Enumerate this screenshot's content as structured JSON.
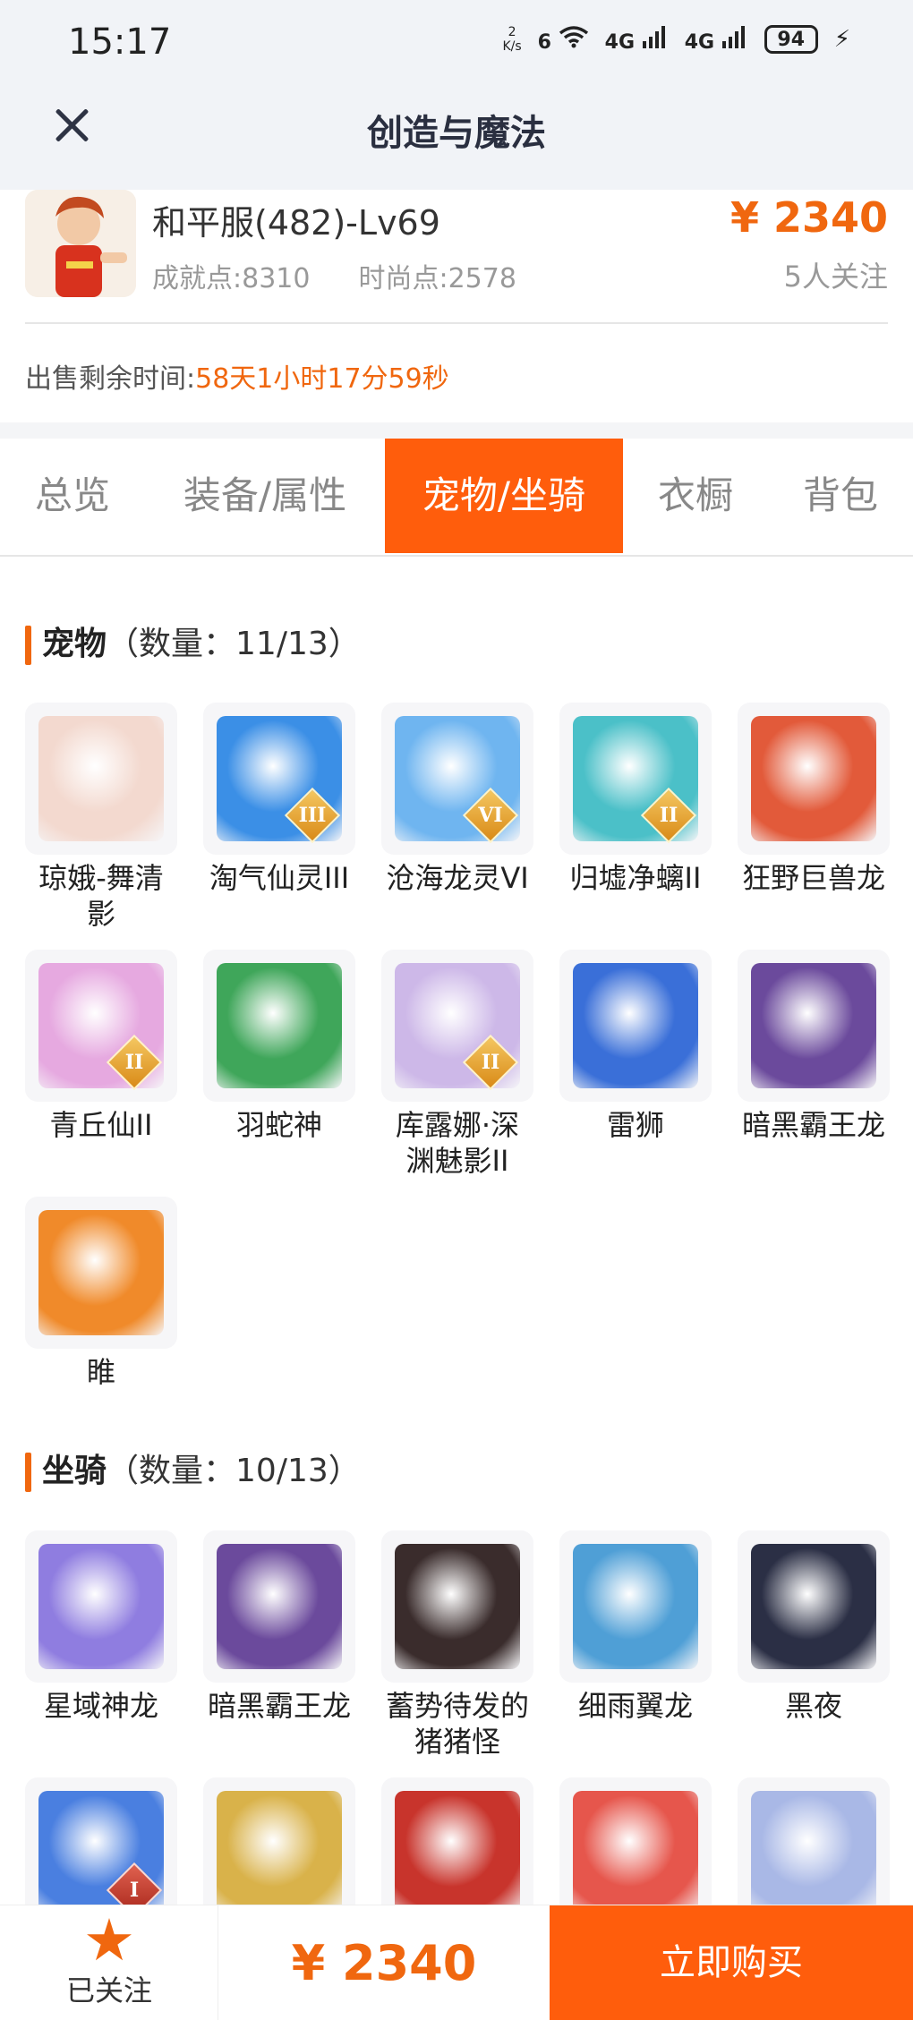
{
  "status_bar": {
    "time": "15:17",
    "net_speed_value": "2",
    "net_speed_unit": "K/s",
    "wifi_label": "6",
    "sig1": "4G",
    "sig2": "4G",
    "battery": "94"
  },
  "header": {
    "title": "创造与魔法"
  },
  "listing": {
    "role_name": "和平服(482)-Lv69",
    "achievement": "成就点:8310",
    "fashion": "时尚点:2578",
    "price": "¥ 2340",
    "followers": "5人关注",
    "sale_time_label": "出售剩余时间:",
    "sale_time_value": "58天1小时17分59秒"
  },
  "tabs": [
    "总览",
    "装备/属性",
    "宠物/坐骑",
    "衣橱",
    "背包"
  ],
  "active_tab": "宠物/坐骑",
  "pets": {
    "title": "宠物",
    "count": "（数量：11/13）",
    "items": [
      {
        "name": "琼娥-舞清影",
        "badge": "",
        "color": "#f3d9cf"
      },
      {
        "name": "淘气仙灵III",
        "badge": "III",
        "color": "#3b8fe6"
      },
      {
        "name": "沧海龙灵VI",
        "badge": "VI",
        "color": "#6fb5f0"
      },
      {
        "name": "归墟净螭II",
        "badge": "II",
        "color": "#4bc0c8"
      },
      {
        "name": "狂野巨兽龙",
        "badge": "",
        "color": "#e25a3a"
      },
      {
        "name": "青丘仙II",
        "badge": "II",
        "color": "#e6a9e0"
      },
      {
        "name": "羽蛇神",
        "badge": "",
        "color": "#3fa65a"
      },
      {
        "name": "库露娜·深渊魅影II",
        "badge": "II",
        "color": "#cdb8e8"
      },
      {
        "name": "雷狮",
        "badge": "",
        "color": "#3a6fd8"
      },
      {
        "name": "暗黑霸王龙",
        "badge": "",
        "color": "#6b4a9c"
      },
      {
        "name": "睢",
        "badge": "",
        "color": "#f08a2a"
      }
    ]
  },
  "mounts": {
    "title": "坐骑",
    "count": "（数量：10/13）",
    "items": [
      {
        "name": "星域神龙",
        "badge": "",
        "color": "#8f7de0"
      },
      {
        "name": "暗黑霸王龙",
        "badge": "",
        "color": "#6b4a9c"
      },
      {
        "name": "蓄势待发的猪猪怪",
        "badge": "",
        "color": "#3a2c2c"
      },
      {
        "name": "细雨翼龙",
        "badge": "",
        "color": "#4f9fd6"
      },
      {
        "name": "黑夜",
        "badge": "",
        "color": "#2b2f45"
      },
      {
        "name": "",
        "badge": "I",
        "color": "#4a7fe0"
      },
      {
        "name": "",
        "badge": "",
        "color": "#d9b24a"
      },
      {
        "name": "",
        "badge": "",
        "color": "#c8342c"
      },
      {
        "name": "",
        "badge": "",
        "color": "#e6564c"
      },
      {
        "name": "",
        "badge": "",
        "color": "#a9b8e6"
      }
    ]
  },
  "bottom_bar": {
    "follow_label": "已关注",
    "price": "¥ 2340",
    "buy_label": "立即购买"
  }
}
